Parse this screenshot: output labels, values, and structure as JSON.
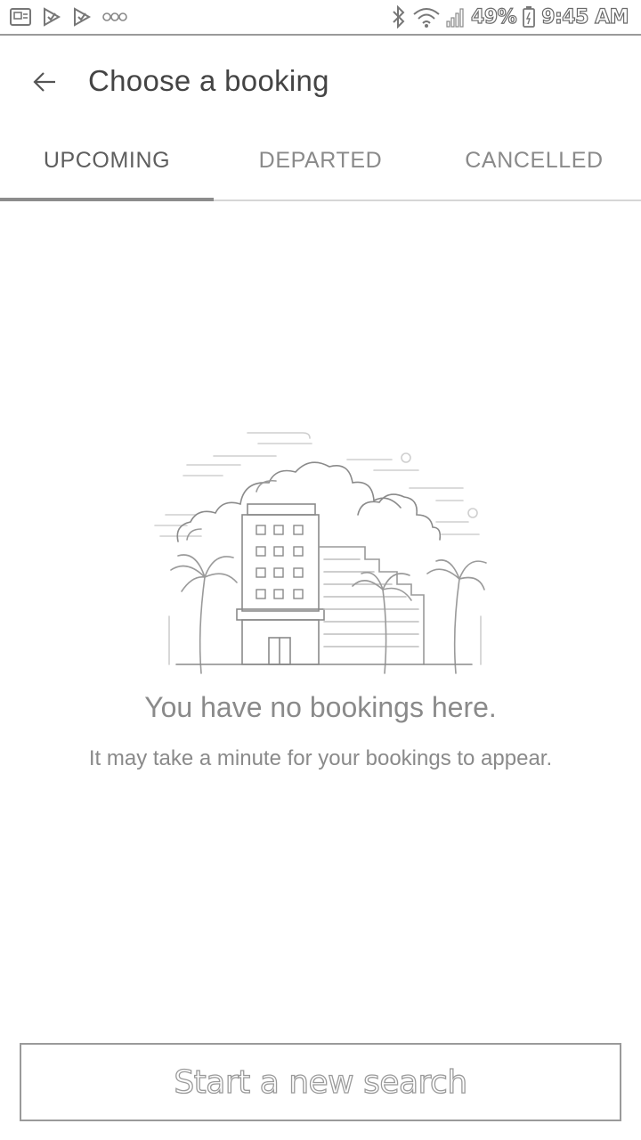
{
  "status_bar": {
    "battery": "49%",
    "time": "9:45 AM",
    "left_icons": [
      "image-notification-icon",
      "check-notification-icon",
      "check-notification-icon",
      "more-dots-icon"
    ],
    "right_icons": [
      "bluetooth-icon",
      "wifi-icon",
      "signal-icon",
      "battery-icon"
    ]
  },
  "header": {
    "title": "Choose a booking",
    "back_icon": "arrow-left-icon"
  },
  "tabs": [
    {
      "label": "UPCOMING",
      "active": true
    },
    {
      "label": "DEPARTED",
      "active": false
    },
    {
      "label": "CANCELLED",
      "active": false
    }
  ],
  "empty_state": {
    "illustration": "hotel-with-palm-trees-illustration",
    "title": "You have no bookings here.",
    "subtitle": "It may take a minute for your bookings to appear."
  },
  "footer": {
    "search_label": "Start a new search"
  },
  "colors": {
    "divider": "#9a9a9a",
    "active_tab_indicator": "#8c8c8c",
    "muted_text": "#8a8a8a"
  }
}
